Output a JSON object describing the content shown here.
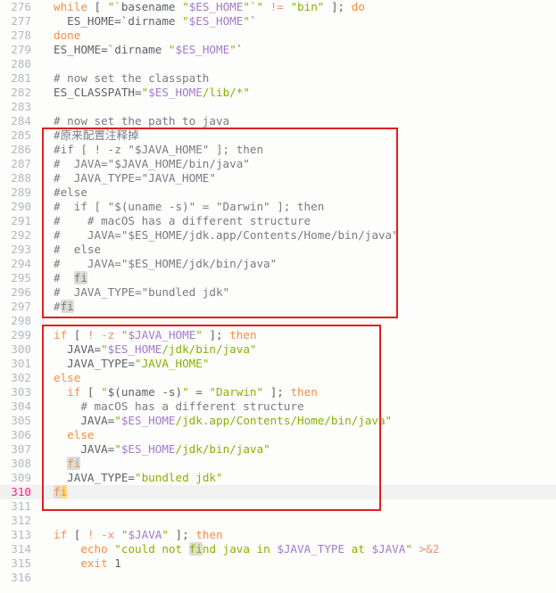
{
  "editor": {
    "current_line": "310",
    "lines": [
      {
        "num": "276",
        "tokens": [
          [
            "kw",
            "while"
          ],
          [
            "plain",
            " [ "
          ],
          [
            "str",
            "\"`"
          ],
          [
            "plain",
            "basename "
          ],
          [
            "str",
            "\""
          ],
          [
            "var",
            "$ES_HOME"
          ],
          [
            "str",
            "\"`\""
          ],
          [
            "plain",
            " "
          ],
          [
            "op",
            "!="
          ],
          [
            "plain",
            " "
          ],
          [
            "str",
            "\"bin\""
          ],
          [
            "plain",
            " ]; "
          ],
          [
            "kw",
            "do"
          ]
        ]
      },
      {
        "num": "277",
        "tokens": [
          [
            "plain",
            "  ES_HOME="
          ],
          [
            "plain",
            "`dirname "
          ],
          [
            "str",
            "\""
          ],
          [
            "var",
            "$ES_HOME"
          ],
          [
            "str",
            "\""
          ],
          [
            "plain",
            "`"
          ]
        ]
      },
      {
        "num": "278",
        "tokens": [
          [
            "kw",
            "done"
          ]
        ]
      },
      {
        "num": "279",
        "tokens": [
          [
            "plain",
            "ES_HOME="
          ],
          [
            "plain",
            "`dirname "
          ],
          [
            "str",
            "\""
          ],
          [
            "var",
            "$ES_HOME"
          ],
          [
            "str",
            "\""
          ],
          [
            "plain",
            "`"
          ]
        ]
      },
      {
        "num": "280",
        "tokens": []
      },
      {
        "num": "281",
        "tokens": [
          [
            "com",
            "# now set the classpath"
          ]
        ]
      },
      {
        "num": "282",
        "tokens": [
          [
            "plain",
            "ES_CLASSPATH="
          ],
          [
            "str",
            "\""
          ],
          [
            "var",
            "$ES_HOME"
          ],
          [
            "str",
            "/lib/*\""
          ]
        ]
      },
      {
        "num": "283",
        "tokens": []
      },
      {
        "num": "284",
        "tokens": [
          [
            "com",
            "# now set the path to java"
          ]
        ]
      },
      {
        "num": "285",
        "tokens": [
          [
            "com",
            "#原来配置注释掉"
          ]
        ]
      },
      {
        "num": "286",
        "tokens": [
          [
            "com",
            "#if [ ! -z \"$JAVA_HOME\" ]; then"
          ]
        ]
      },
      {
        "num": "287",
        "tokens": [
          [
            "com",
            "#  JAVA=\"$JAVA_HOME/bin/java\""
          ]
        ]
      },
      {
        "num": "288",
        "tokens": [
          [
            "com",
            "#  JAVA_TYPE=\"JAVA_HOME\""
          ]
        ]
      },
      {
        "num": "289",
        "tokens": [
          [
            "com",
            "#else"
          ]
        ]
      },
      {
        "num": "290",
        "tokens": [
          [
            "com",
            "#  if [ \"$(uname -s)\" = \"Darwin\" ]; then"
          ]
        ]
      },
      {
        "num": "291",
        "tokens": [
          [
            "com",
            "#    # macOS has a different structure"
          ]
        ]
      },
      {
        "num": "292",
        "tokens": [
          [
            "com",
            "#    JAVA=\"$ES_HOME/jdk.app/Contents/Home/bin/java\""
          ]
        ]
      },
      {
        "num": "293",
        "tokens": [
          [
            "com",
            "#  else"
          ]
        ]
      },
      {
        "num": "294",
        "tokens": [
          [
            "com",
            "#    JAVA=\"$ES_HOME/jdk/bin/java\""
          ]
        ]
      },
      {
        "num": "295",
        "tokens": [
          [
            "com",
            "#  "
          ],
          [
            "hlcom",
            "fi"
          ]
        ]
      },
      {
        "num": "296",
        "tokens": [
          [
            "com",
            "#  JAVA_TYPE=\"bundled jdk\""
          ]
        ]
      },
      {
        "num": "297",
        "tokens": [
          [
            "com",
            "#"
          ],
          [
            "hlcom",
            "fi"
          ]
        ]
      },
      {
        "num": "298",
        "tokens": []
      },
      {
        "num": "299",
        "tokens": [
          [
            "kw",
            "if"
          ],
          [
            "plain",
            " [ "
          ],
          [
            "op",
            "! -z"
          ],
          [
            "plain",
            " "
          ],
          [
            "str",
            "\""
          ],
          [
            "var",
            "$JAVA_HOME"
          ],
          [
            "str",
            "\""
          ],
          [
            "plain",
            " ]; "
          ],
          [
            "kw",
            "then"
          ]
        ]
      },
      {
        "num": "300",
        "tokens": [
          [
            "plain",
            "  JAVA="
          ],
          [
            "str",
            "\""
          ],
          [
            "var",
            "$ES_HOME"
          ],
          [
            "str",
            "/jdk/bin/java\""
          ]
        ]
      },
      {
        "num": "301",
        "tokens": [
          [
            "plain",
            "  JAVA_TYPE="
          ],
          [
            "str",
            "\"JAVA_HOME\""
          ]
        ]
      },
      {
        "num": "302",
        "tokens": [
          [
            "kw",
            "else"
          ]
        ]
      },
      {
        "num": "303",
        "tokens": [
          [
            "plain",
            "  "
          ],
          [
            "kw",
            "if"
          ],
          [
            "plain",
            " [ "
          ],
          [
            "str",
            "\""
          ],
          [
            "plain",
            "$(uname -s)"
          ],
          [
            "str",
            "\""
          ],
          [
            "plain",
            " = "
          ],
          [
            "str",
            "\"Darwin\""
          ],
          [
            "plain",
            " ]; "
          ],
          [
            "kw",
            "then"
          ]
        ]
      },
      {
        "num": "304",
        "tokens": [
          [
            "com",
            "    # macOS has a different structure"
          ]
        ]
      },
      {
        "num": "305",
        "tokens": [
          [
            "plain",
            "    JAVA="
          ],
          [
            "str",
            "\""
          ],
          [
            "var",
            "$ES_HOME"
          ],
          [
            "str",
            "/jdk.app/Contents/Home/bin/java\""
          ]
        ]
      },
      {
        "num": "306",
        "tokens": [
          [
            "plain",
            "  "
          ],
          [
            "kw",
            "else"
          ]
        ]
      },
      {
        "num": "307",
        "tokens": [
          [
            "plain",
            "    JAVA="
          ],
          [
            "str",
            "\""
          ],
          [
            "var",
            "$ES_HOME"
          ],
          [
            "str",
            "/jdk/bin/java\""
          ]
        ]
      },
      {
        "num": "308",
        "tokens": [
          [
            "plain",
            "  "
          ],
          [
            "hlkw",
            "fi"
          ]
        ]
      },
      {
        "num": "309",
        "tokens": [
          [
            "plain",
            "  JAVA_TYPE="
          ],
          [
            "str",
            "\"bundled jdk\""
          ]
        ]
      },
      {
        "num": "310",
        "tokens": [
          [
            "hlkw",
            "f"
          ],
          [
            "cursor",
            "i"
          ]
        ]
      },
      {
        "num": "311",
        "tokens": []
      },
      {
        "num": "312",
        "tokens": []
      },
      {
        "num": "313",
        "tokens": [
          [
            "kw",
            "if"
          ],
          [
            "plain",
            " [ "
          ],
          [
            "op",
            "! -x"
          ],
          [
            "plain",
            " "
          ],
          [
            "str",
            "\""
          ],
          [
            "var",
            "$JAVA"
          ],
          [
            "str",
            "\""
          ],
          [
            "plain",
            " ]; "
          ],
          [
            "kw",
            "then"
          ]
        ]
      },
      {
        "num": "314",
        "tokens": [
          [
            "plain",
            "    "
          ],
          [
            "kw",
            "echo"
          ],
          [
            "plain",
            " "
          ],
          [
            "str",
            "\"could not "
          ],
          [
            "hlstr",
            "fi"
          ],
          [
            "str",
            "nd java in "
          ],
          [
            "var",
            "$JAVA_TYPE"
          ],
          [
            "str",
            " at "
          ],
          [
            "var",
            "$JAVA"
          ],
          [
            "str",
            "\""
          ],
          [
            "plain",
            " "
          ],
          [
            "op",
            ">&2"
          ]
        ]
      },
      {
        "num": "315",
        "tokens": [
          [
            "plain",
            "    "
          ],
          [
            "kw",
            "exit"
          ],
          [
            "plain",
            " 1"
          ]
        ]
      },
      {
        "num": "316",
        "tokens": []
      }
    ]
  },
  "colors": {
    "keyword": "#fa8d3e",
    "string": "#86b300",
    "variable": "#a37acc",
    "comment": "#787b80",
    "annotation_box": "#e0201f",
    "current_line_number": "#ff1f8a"
  }
}
